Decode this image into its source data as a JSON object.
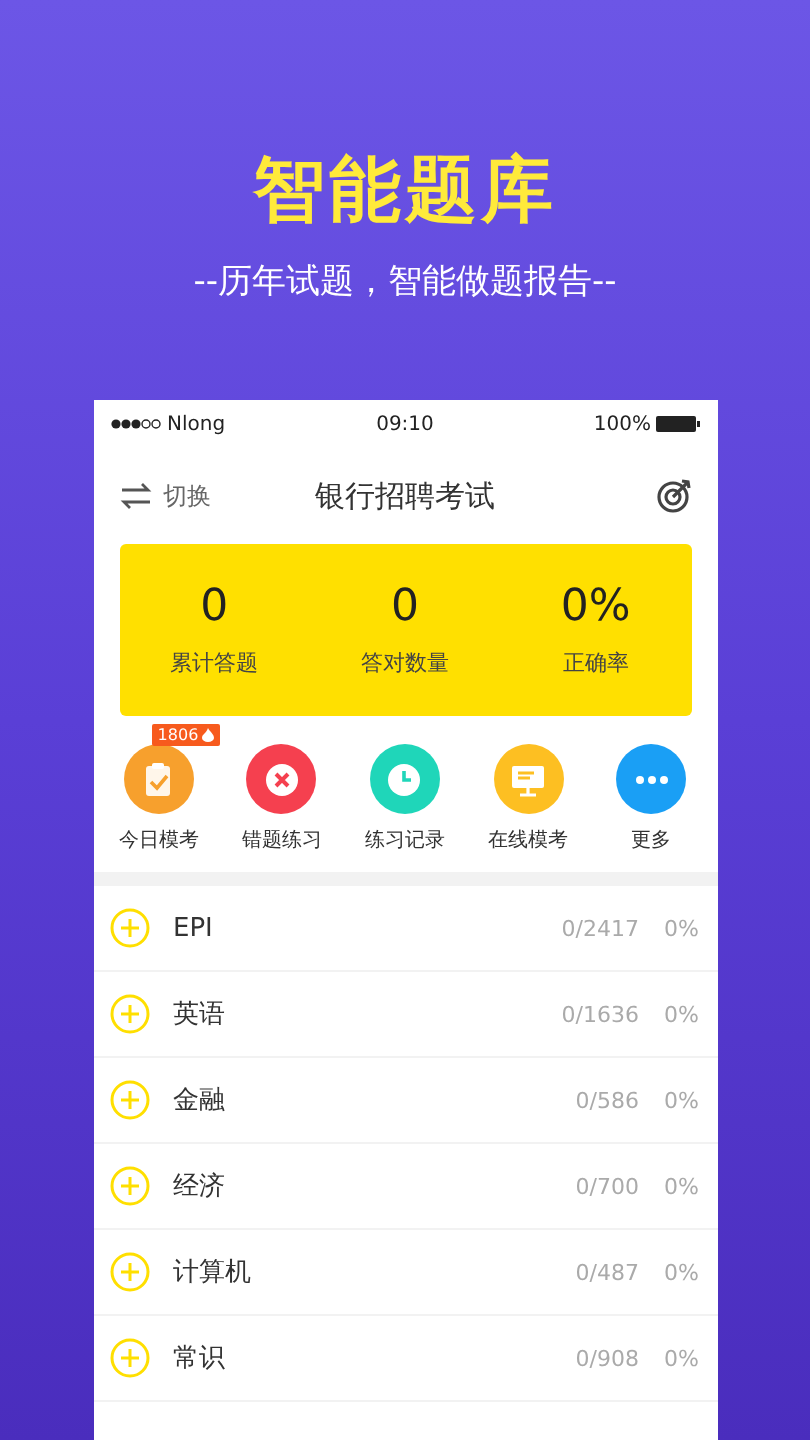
{
  "headline": "智能题库",
  "subtitle": "--历年试题，智能做题报告--",
  "status_bar": {
    "carrier": "Nlong",
    "time": "09:10",
    "battery": "100%"
  },
  "header": {
    "switch_label": "切换",
    "title": "银行招聘考试"
  },
  "stats": [
    {
      "value": "0",
      "label": "累计答题"
    },
    {
      "value": "0",
      "label": "答对数量"
    },
    {
      "value": "0%",
      "label": "正确率"
    }
  ],
  "shortcuts": [
    {
      "kind": "clipboard",
      "label": "今日模考",
      "color": "#f7a02d",
      "badge": "1806"
    },
    {
      "kind": "cross",
      "label": "错题练习",
      "color": "#f5404f"
    },
    {
      "kind": "clock",
      "label": "练习记录",
      "color": "#1fd6b9"
    },
    {
      "kind": "monitor",
      "label": "在线模考",
      "color": "#fdbf22"
    },
    {
      "kind": "dots",
      "label": "更多",
      "color": "#1a9ff5"
    }
  ],
  "subjects": [
    {
      "name": "EPI",
      "count": "0/2417",
      "rate": "0%"
    },
    {
      "name": "英语",
      "count": "0/1636",
      "rate": "0%"
    },
    {
      "name": "金融",
      "count": "0/586",
      "rate": "0%"
    },
    {
      "name": "经济",
      "count": "0/700",
      "rate": "0%"
    },
    {
      "name": "计算机",
      "count": "0/487",
      "rate": "0%"
    },
    {
      "name": "常识",
      "count": "0/908",
      "rate": "0%"
    }
  ]
}
